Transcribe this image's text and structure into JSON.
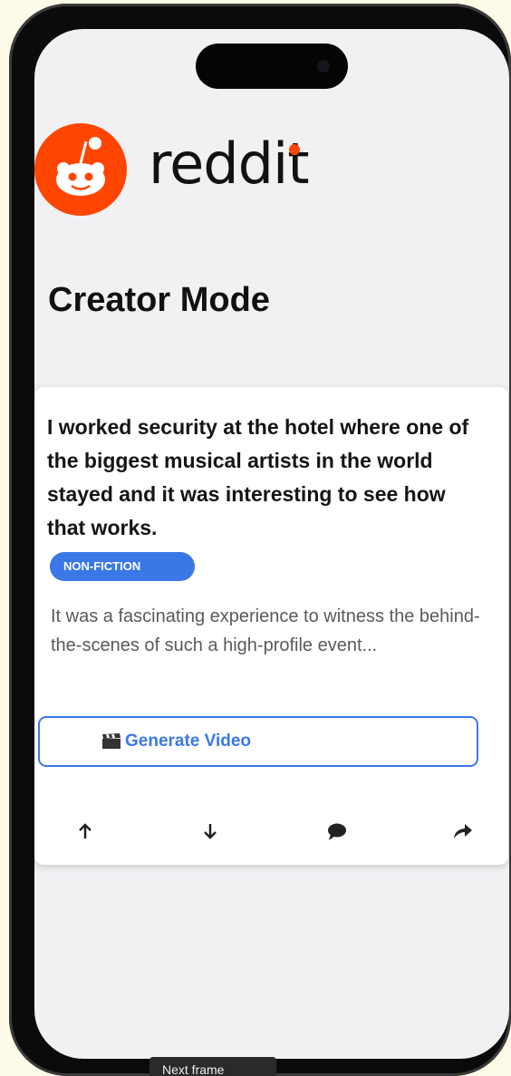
{
  "brand": {
    "name": "reddit",
    "logo_icon": "reddit-snoo-icon",
    "brand_color": "#ff4500"
  },
  "page": {
    "title": "Creator Mode"
  },
  "post": {
    "title": "I worked security at the hotel where one of the biggest musical artists in the world stayed and it was interesting to see how that works.",
    "tag": "NON-FICTION",
    "excerpt": "It was a fascinating experience to witness the behind-the-scenes of such a high-profile event...",
    "generate_button": {
      "icon": "clapperboard-icon",
      "label": "Generate Video"
    },
    "actions": [
      {
        "name": "upvote",
        "icon": "arrow-up-icon"
      },
      {
        "name": "downvote",
        "icon": "arrow-down-icon"
      },
      {
        "name": "comment",
        "icon": "comment-icon"
      },
      {
        "name": "share",
        "icon": "share-icon"
      }
    ]
  },
  "bottom_tab": {
    "label": "Next frame"
  },
  "colors": {
    "accent": "#3b78e7",
    "background": "#f1f1f4",
    "card": "#ffffff"
  }
}
